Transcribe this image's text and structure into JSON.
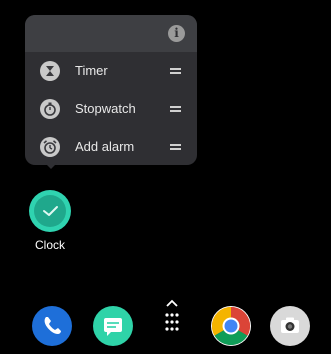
{
  "popup": {
    "info_label": "i",
    "shortcuts": [
      {
        "label": "Timer",
        "icon": "hourglass-icon"
      },
      {
        "label": "Stopwatch",
        "icon": "stopwatch-icon"
      },
      {
        "label": "Add alarm",
        "icon": "alarm-icon"
      }
    ]
  },
  "home": {
    "apps": [
      {
        "label": "Clock",
        "icon": "clock-icon",
        "color": "#2fd3b0"
      }
    ]
  },
  "dock": {
    "items": [
      {
        "icon": "phone-icon",
        "color": "#1e6fd9"
      },
      {
        "icon": "messages-icon",
        "color": "#2fd3a8"
      },
      {
        "icon": "app-drawer-icon"
      },
      {
        "icon": "chrome-icon"
      },
      {
        "icon": "camera-icon",
        "color": "#d9d9d9"
      }
    ]
  }
}
